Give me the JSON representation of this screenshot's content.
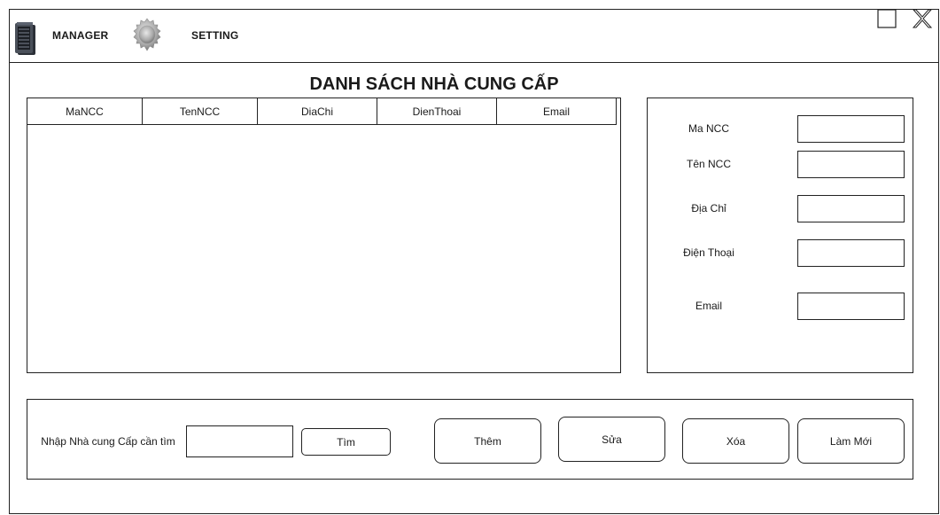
{
  "toolbar": {
    "manager_label": "MANAGER",
    "setting_label": "SETTING"
  },
  "window_controls": {
    "maximize_icon": "square-icon",
    "close_icon": "x-icon"
  },
  "page_title": "DANH SÁCH NHÀ CUNG CẤP",
  "table": {
    "columns": [
      "MaNCC",
      "TenNCC",
      "DiaChi",
      "DienThoai",
      "Email"
    ],
    "rows": []
  },
  "form": {
    "ma_ncc_label": "Ma NCC",
    "ten_ncc_label": "Tên NCC",
    "dia_chi_label": "Địa Chỉ",
    "dien_thoai_label": "Điện Thoại",
    "email_label": "Email"
  },
  "search": {
    "label": "Nhập Nhà cung Cấp cần tìm",
    "button": "Tìm"
  },
  "actions": {
    "add": "Thêm",
    "edit": "Sửa",
    "delete": "Xóa",
    "refresh": "Làm Mới"
  }
}
